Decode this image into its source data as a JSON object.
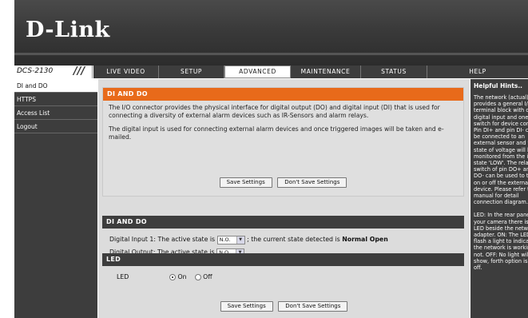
{
  "brand": {
    "logo": "D-Link",
    "model": "DCS-2130",
    "slashes": "///"
  },
  "nav": {
    "tabs": [
      "LIVE VIDEO",
      "SETUP",
      "ADVANCED",
      "MAINTENANCE",
      "STATUS",
      "HELP"
    ],
    "active": "ADVANCED"
  },
  "sidebar": {
    "items": [
      "DI and DO",
      "HTTPS",
      "Access List",
      "Logout"
    ],
    "active": "DI and DO"
  },
  "intro": {
    "title": "DI AND DO",
    "text1": "The I/O connector provides the physical interface for digital output (DO) and digital input (DI) that is used for connecting a diversity of external alarm devices such as IR-Sensors and alarm relays.",
    "text2": "The digital input is used for connecting external alarm devices and once triggered images will be taken and e-mailed.",
    "save": "Save Settings",
    "dont_save": "Don't Save Settings"
  },
  "dido": {
    "title": "DI AND DO",
    "input_prefix": "Digital Input 1: The active state is",
    "input_value": "N.O.",
    "input_mid": "; the current state detected is",
    "input_state": "Normal Open",
    "output_prefix": "Digital Output: The active state is",
    "output_value": "N.O."
  },
  "led": {
    "title": "LED",
    "label": "LED",
    "on": "On",
    "off": "Off",
    "selected": "On"
  },
  "bottom_buttons": {
    "save": "Save Settings",
    "dont_save": "Don't Save Settings"
  },
  "hints": {
    "title": "Helpful Hints..",
    "lines": [
      "The network (actual) pr",
      "provides a general I/O",
      "terminal block with one",
      "digital input and one r",
      "switch for device cont",
      "Pin DI+ and pin DI- ca",
      "be connected to an",
      "external sensor and th",
      "state of voltage will be",
      "monitored from the in",
      "state 'LOW'. The relay",
      "switch of pin DO+ and",
      "DO- can be used to tu",
      "on or off the external",
      "device. Please refer t",
      "manual for detail",
      "connection diagram."
    ],
    "led_lines": [
      "LED: In the rear panel",
      "your camera there is a",
      "LED beside the netwo",
      "adapter. ON: The LED",
      "flash a light to indicat",
      "the network is working",
      "not. OFF: No light will",
      "show, forth option is t",
      "off."
    ]
  }
}
